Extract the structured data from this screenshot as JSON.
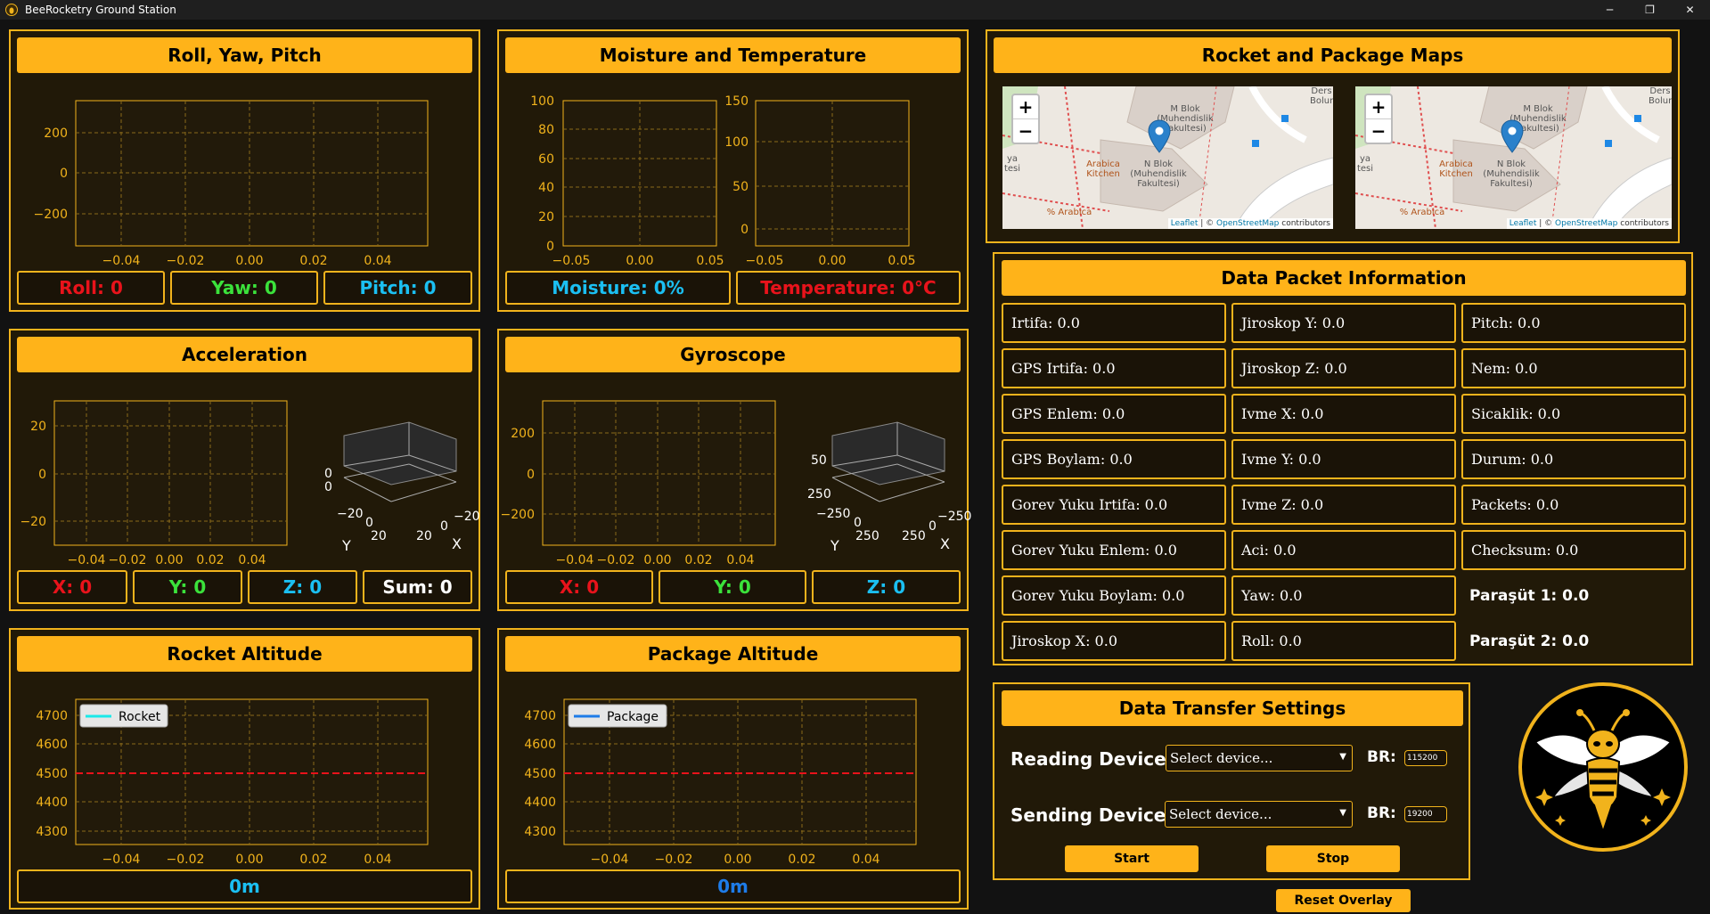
{
  "window": {
    "title": "BeeRocketry Ground Station",
    "minimize": "─",
    "maximize": "❐",
    "close": "✕"
  },
  "colors": {
    "accent": "#ffb319",
    "panel_bg": "#211908",
    "red": "#e8131b",
    "green": "#3be23b",
    "cyan": "#1bbff2",
    "blue": "#1e7ce8"
  },
  "rpy": {
    "title": "Roll,  Yaw,  Pitch",
    "roll": "Roll: 0",
    "yaw": "Yaw: 0",
    "pitch": "Pitch: 0",
    "yticks": [
      "200",
      "0",
      "−200"
    ],
    "xticks": [
      "−0.04",
      "−0.02",
      "0.00",
      "0.02",
      "0.04"
    ]
  },
  "moist": {
    "title": "Moisture and Temperature",
    "moisture": "Moisture: 0%",
    "temperature": "Temperature: 0°C",
    "moist_yticks": [
      "100",
      "80",
      "60",
      "40",
      "20",
      "0"
    ],
    "temp_yticks": [
      "150",
      "100",
      "50",
      "0"
    ],
    "xticks": [
      "−0.05",
      "0.00",
      "0.05"
    ]
  },
  "accel": {
    "title": "Acceleration",
    "x": "X: 0",
    "y": "Y: 0",
    "z": "Z: 0",
    "sum": "Sum: 0",
    "yticks": [
      "20",
      "0",
      "−20"
    ],
    "xticks": [
      "−0.04",
      "−0.02",
      "0.00",
      "0.02",
      "0.04"
    ],
    "p3d": {
      "left_ticks": [
        "−20",
        "0",
        "20"
      ],
      "right_ticks": [
        "20",
        "0",
        "−20"
      ],
      "ylab": "Y",
      "xlab": "X",
      "side_ticks": [
        "0",
        "0"
      ]
    }
  },
  "gyro": {
    "title": "Gyroscope",
    "x": "X: 0",
    "y": "Y: 0",
    "z": "Z: 0",
    "yticks": [
      "200",
      "0",
      "−200"
    ],
    "xticks": [
      "−0.04",
      "−0.02",
      "0.00",
      "0.02",
      "0.04"
    ],
    "p3d": {
      "left_ticks": [
        "−250",
        "0",
        "250"
      ],
      "right_ticks": [
        "250",
        "0",
        "−250"
      ],
      "ylab": "Y",
      "xlab": "X",
      "side_ticks": [
        "50",
        "250"
      ]
    }
  },
  "rocket_alt": {
    "title": "Rocket Altitude",
    "value": "0m",
    "legend": "Rocket",
    "yticks": [
      "4700",
      "4600",
      "4500",
      "4400",
      "4300"
    ],
    "xticks": [
      "−0.04",
      "−0.02",
      "0.00",
      "0.02",
      "0.04"
    ]
  },
  "package_alt": {
    "title": "Package Altitude",
    "value": "0m",
    "legend": "Package",
    "yticks": [
      "4700",
      "4600",
      "4500",
      "4400",
      "4300"
    ],
    "xticks": [
      "−0.04",
      "−0.02",
      "0.00",
      "0.02",
      "0.04"
    ]
  },
  "chart_data": [
    {
      "type": "line",
      "title": "Roll,  Yaw,  Pitch",
      "xlim": [
        -0.05,
        0.05
      ],
      "ylim": [
        -350,
        350
      ],
      "series": [],
      "grid": true
    },
    {
      "type": "line",
      "title": "Moisture",
      "xlim": [
        -0.05,
        0.05
      ],
      "ylim": [
        0,
        100
      ],
      "series": [],
      "grid": true
    },
    {
      "type": "line",
      "title": "Temperature",
      "xlim": [
        -0.05,
        0.05
      ],
      "ylim": [
        -10,
        150
      ],
      "series": [],
      "grid": true
    },
    {
      "type": "line",
      "title": "Acceleration",
      "xlim": [
        -0.05,
        0.05
      ],
      "ylim": [
        -30,
        30
      ],
      "series": [],
      "grid": true
    },
    {
      "type": "line",
      "title": "Gyroscope",
      "xlim": [
        -0.05,
        0.05
      ],
      "ylim": [
        -350,
        350
      ],
      "series": [],
      "grid": true
    },
    {
      "type": "line",
      "title": "Rocket Altitude",
      "xlim": [
        -0.055,
        0.055
      ],
      "ylim": [
        4250,
        4750
      ],
      "reference_line": 4500,
      "legend_position": "top-left",
      "series": [
        {
          "name": "Rocket",
          "x": [],
          "y": []
        }
      ],
      "grid": true
    },
    {
      "type": "line",
      "title": "Package Altitude",
      "xlim": [
        -0.055,
        0.055
      ],
      "ylim": [
        4250,
        4750
      ],
      "reference_line": 4500,
      "legend_position": "top-left",
      "series": [
        {
          "name": "Package",
          "x": [],
          "y": []
        }
      ],
      "grid": true
    }
  ],
  "maps": {
    "title": "Rocket and Package Maps",
    "zoom_in": "+",
    "zoom_out": "−",
    "attribution_leaflet": "Leaflet",
    "attribution_sep": " | © ",
    "attribution_osm": "OpenStreetMap",
    "attribution_tail": " contributors",
    "label_mblok": "M Blok (Muhendislik Fakultesi)",
    "label_nblok": "N Blok (Muhendislik Fakultesi)",
    "label_arabica_kitchen": "Arabica Kitchen",
    "label_arabica": "% Arabica",
    "label_ders": "Ders Bolum",
    "label_ya": "ya tesi"
  },
  "packet": {
    "title": "Data Packet Information",
    "col1": [
      "Irtifa: 0.0",
      "GPS Irtifa: 0.0",
      "GPS Enlem: 0.0",
      "GPS Boylam: 0.0",
      "Gorev Yuku Irtifa: 0.0",
      "Gorev Yuku Enlem: 0.0",
      "Gorev Yuku Boylam: 0.0",
      "Jiroskop X: 0.0"
    ],
    "col2": [
      "Jiroskop Y: 0.0",
      "Jiroskop Z: 0.0",
      "Ivme X: 0.0",
      "Ivme Y: 0.0",
      "Ivme Z: 0.0",
      "Aci: 0.0",
      "Yaw: 0.0",
      "Roll: 0.0"
    ],
    "col3": [
      "Pitch: 0.0",
      "Nem: 0.0",
      "Sicaklik: 0.0",
      "Durum: 0.0",
      "Packets: 0.0",
      "Checksum: 0.0",
      "Paraşüt 1: 0.0",
      "Paraşüt 2: 0.0"
    ]
  },
  "transfer": {
    "title": "Data  Transfer  Settings",
    "reading_label": "Reading Device:",
    "sending_label": "Sending Device:",
    "reading_select": "Select device...",
    "sending_select": "Select device...",
    "br_label": "BR:",
    "reading_br": "115200",
    "sending_br": "19200",
    "start": "Start",
    "stop": "Stop",
    "reset": "Reset Overlay"
  }
}
